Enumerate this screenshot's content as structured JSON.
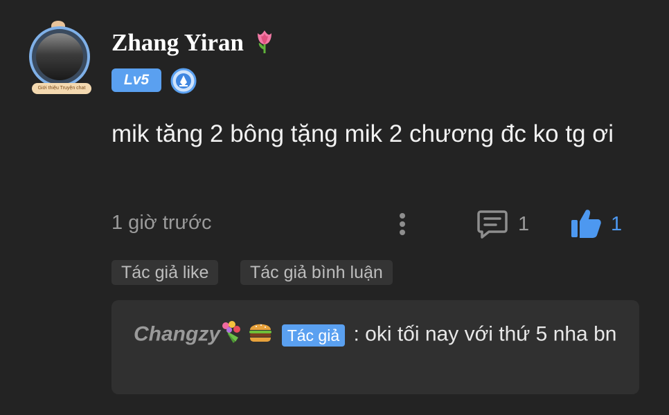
{
  "user": {
    "name": "Zhang Yiran",
    "level": "Lv5",
    "avatar_tag": "Giới thiệu Truyện chat"
  },
  "comment": {
    "text": "mik tăng 2 bông tặng mik 2 chương đc ko tg ơi",
    "time": "1 giờ trước",
    "reply_count": "1",
    "like_count": "1"
  },
  "chips": [
    "Tác giả like",
    "Tác giả bình luận"
  ],
  "reply": {
    "user": "Changzy",
    "badge": "Tác giả",
    "text": ": oki tối nay với thứ 5 nha bn"
  },
  "colors": {
    "background": "#232323",
    "accent": "#5aa0f0",
    "like": "#4d98f0"
  },
  "icons": [
    "tulip-icon",
    "medal-icon",
    "more-icon",
    "comment-icon",
    "thumbs-up-icon",
    "bouquet-icon",
    "burger-icon"
  ]
}
